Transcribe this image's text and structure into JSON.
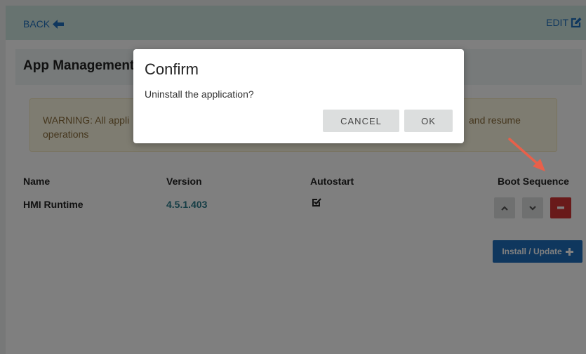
{
  "header": {
    "back_label": "BACK",
    "back_icon": "arrow-left-icon",
    "edit_label": "EDIT",
    "edit_icon": "edit-icon"
  },
  "page": {
    "title": "App Management"
  },
  "warning": {
    "text_start": "WARNING: All appli",
    "text_end": "and resume",
    "text_line2": "operations"
  },
  "table": {
    "headers": {
      "name": "Name",
      "version": "Version",
      "autostart": "Autostart",
      "boot_sequence": "Boot Sequence"
    },
    "rows": [
      {
        "name": "HMI Runtime",
        "version": "4.5.1.403",
        "autostart": true
      }
    ]
  },
  "install_button": {
    "label": "Install / Update",
    "icon": "plus-icon"
  },
  "dialog": {
    "title": "Confirm",
    "message": "Uninstall the application?",
    "cancel_label": "CANCEL",
    "ok_label": "OK"
  },
  "colors": {
    "link": "#1f6fbd",
    "header_bg": "#cfe6e1",
    "danger": "#d23434",
    "warning_bg": "#fcf8e3",
    "warning_text": "#8a6d3b",
    "version_text": "#2a7a8a",
    "annotation_arrow": "#e8604a"
  }
}
